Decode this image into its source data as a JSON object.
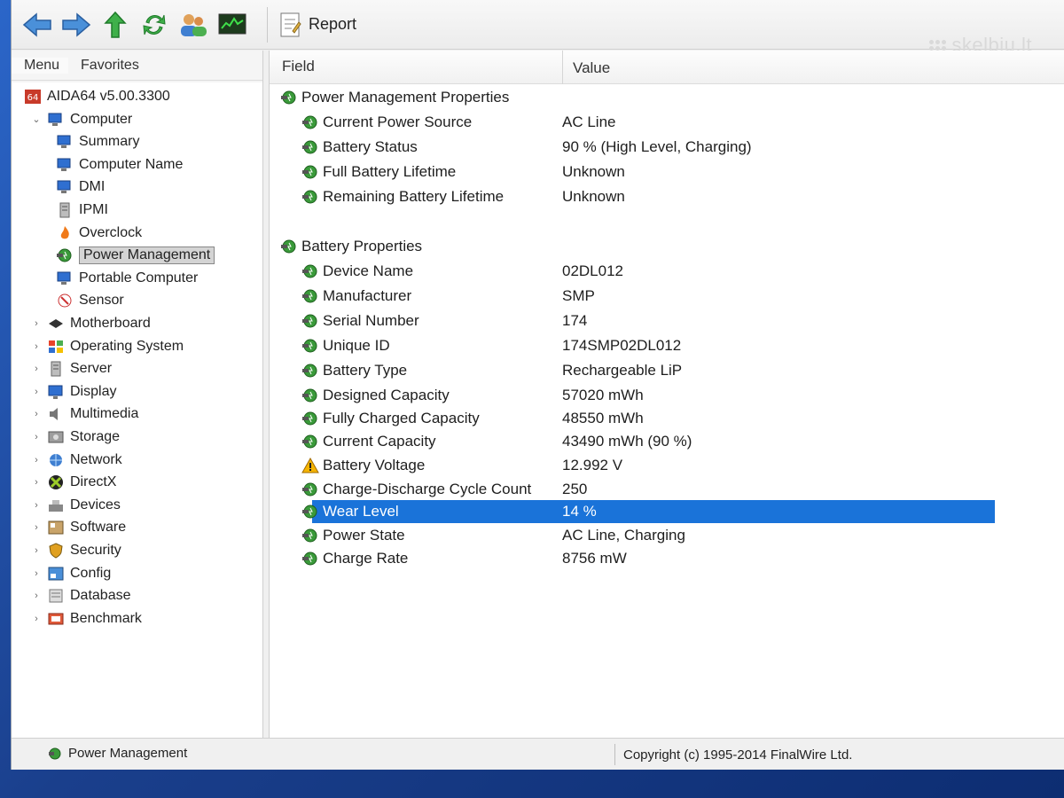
{
  "toolbar": {
    "report_label": "Report",
    "buttons": [
      "back-icon",
      "forward-icon",
      "up-icon",
      "refresh-icon",
      "users-icon",
      "monitor-icon"
    ]
  },
  "watermark": "skelbiu.lt",
  "left_pane": {
    "tab_menu": "Menu",
    "tab_favorites": "Favorites",
    "tree": [
      {
        "label": "AIDA64 v5.00.3300",
        "level": 0,
        "icon": "aida-icon"
      },
      {
        "label": "Computer",
        "level": 1,
        "icon": "computer-icon",
        "expanded": true
      },
      {
        "label": "Summary",
        "level": 2,
        "icon": "computer-icon"
      },
      {
        "label": "Computer Name",
        "level": 2,
        "icon": "computer-icon"
      },
      {
        "label": "DMI",
        "level": 2,
        "icon": "computer-icon"
      },
      {
        "label": "IPMI",
        "level": 2,
        "icon": "server-icon"
      },
      {
        "label": "Overclock",
        "level": 2,
        "icon": "flame-icon"
      },
      {
        "label": "Power Management",
        "level": 2,
        "icon": "power-icon",
        "selected": true
      },
      {
        "label": "Portable Computer",
        "level": 2,
        "icon": "computer-icon"
      },
      {
        "label": "Sensor",
        "level": 2,
        "icon": "sensor-icon"
      },
      {
        "label": "Motherboard",
        "level": 1,
        "icon": "motherboard-icon"
      },
      {
        "label": "Operating System",
        "level": 1,
        "icon": "windows-icon"
      },
      {
        "label": "Server",
        "level": 1,
        "icon": "server-icon"
      },
      {
        "label": "Display",
        "level": 1,
        "icon": "display-icon"
      },
      {
        "label": "Multimedia",
        "level": 1,
        "icon": "speaker-icon"
      },
      {
        "label": "Storage",
        "level": 1,
        "icon": "storage-icon"
      },
      {
        "label": "Network",
        "level": 1,
        "icon": "network-icon"
      },
      {
        "label": "DirectX",
        "level": 1,
        "icon": "directx-icon"
      },
      {
        "label": "Devices",
        "level": 1,
        "icon": "devices-icon"
      },
      {
        "label": "Software",
        "level": 1,
        "icon": "software-icon"
      },
      {
        "label": "Security",
        "level": 1,
        "icon": "security-icon"
      },
      {
        "label": "Config",
        "level": 1,
        "icon": "config-icon"
      },
      {
        "label": "Database",
        "level": 1,
        "icon": "database-icon"
      },
      {
        "label": "Benchmark",
        "level": 1,
        "icon": "benchmark-icon"
      }
    ]
  },
  "list": {
    "header_field": "Field",
    "header_value": "Value",
    "rows": [
      {
        "field": "Power Management Properties",
        "value": "",
        "group": true
      },
      {
        "field": "Current Power Source",
        "value": "AC Line"
      },
      {
        "field": "Battery Status",
        "value": "90 % (High Level, Charging)"
      },
      {
        "field": "Full Battery Lifetime",
        "value": "Unknown"
      },
      {
        "field": "Remaining Battery Lifetime",
        "value": "Unknown"
      },
      {
        "field": "Battery Properties",
        "value": "",
        "group": true
      },
      {
        "field": "Device Name",
        "value": "02DL012"
      },
      {
        "field": "Manufacturer",
        "value": "SMP"
      },
      {
        "field": "Serial Number",
        "value": "174"
      },
      {
        "field": "Unique ID",
        "value": "174SMP02DL012"
      },
      {
        "field": "Battery Type",
        "value": "Rechargeable LiP"
      },
      {
        "field": "Designed Capacity",
        "value": "57020 mWh"
      },
      {
        "field": "Fully Charged Capacity",
        "value": "48550 mWh"
      },
      {
        "field": "Current Capacity",
        "value": "43490 mWh  (90 %)"
      },
      {
        "field": "Battery Voltage",
        "value": "12.992 V",
        "warning": true
      },
      {
        "field": "Charge-Discharge Cycle Count",
        "value": "250"
      },
      {
        "field": "Wear Level",
        "value": "14 %",
        "selected": true
      },
      {
        "field": "Power State",
        "value": "AC Line, Charging"
      },
      {
        "field": "Charge Rate",
        "value": "8756 mW"
      }
    ]
  },
  "statusbar": {
    "left": "Power Management",
    "right": "Copyright (c) 1995-2014 FinalWire Ltd."
  },
  "colors": {
    "selection": "#1a73d9",
    "tree_selected": "#d4d4d4"
  }
}
